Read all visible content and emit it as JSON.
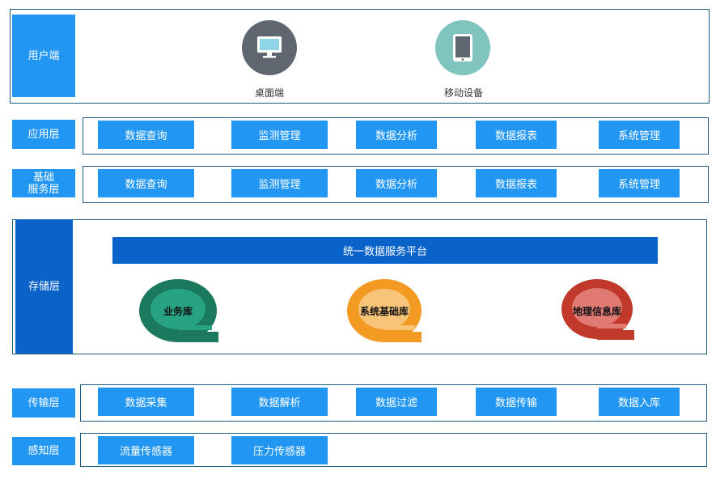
{
  "user_layer": {
    "label": "用户端",
    "devices": [
      {
        "name": "桌面端",
        "icon": "desktop-monitor-icon",
        "color": "#5f6670"
      },
      {
        "name": "移动设备",
        "icon": "tablet-icon",
        "color": "#7fc4bf"
      }
    ]
  },
  "app_layer": {
    "label": "应用层",
    "items": [
      "数据查询",
      "监测管理",
      "数据分析",
      "数据报表",
      "系统管理"
    ]
  },
  "base_layer": {
    "label_line1": "基础",
    "label_line2": "服务层",
    "items": [
      "数据查询",
      "监测管理",
      "数据分析",
      "数据报表",
      "系统管理"
    ]
  },
  "storage_layer": {
    "label": "存储层",
    "platform": "统一数据服务平台",
    "databases": [
      {
        "name": "业务库",
        "outer": "#1b7a5e",
        "inner": "#27a383"
      },
      {
        "name": "系统基础库",
        "outer": "#f29a21",
        "inner": "#f7c47a"
      },
      {
        "name": "地理信息库",
        "outer": "#c0392b",
        "inner": "#e07a72"
      }
    ]
  },
  "transport_layer": {
    "label": "传输层",
    "items": [
      "数据采集",
      "数据解析",
      "数据过滤",
      "数据传输",
      "数据入库"
    ]
  },
  "sensing_layer": {
    "label": "感知层",
    "items": [
      "流量传感器",
      "压力传感器"
    ]
  },
  "colors": {
    "accent": "#2196f3",
    "dark_accent": "#0a63c9",
    "frame_border": "#1f5c7a"
  }
}
